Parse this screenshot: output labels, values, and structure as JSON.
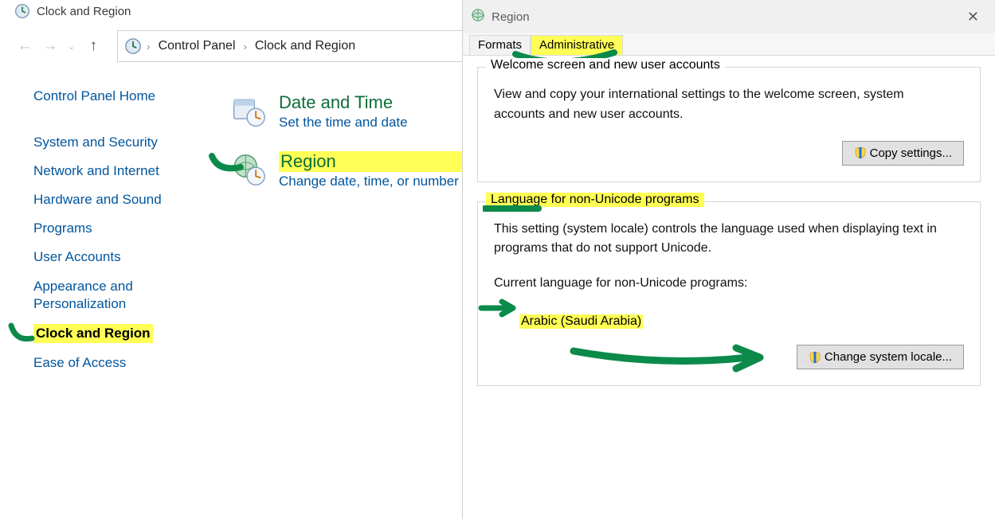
{
  "window": {
    "title": "Clock and Region"
  },
  "breadcrumb": {
    "items": [
      "Control Panel",
      "Clock and Region"
    ]
  },
  "sidebar": {
    "home": "Control Panel Home",
    "items": [
      "System and Security",
      "Network and Internet",
      "Hardware and Sound",
      "Programs",
      "User Accounts",
      "Appearance and Personalization",
      "Clock and Region",
      "Ease of Access"
    ],
    "active_index": 6
  },
  "main": {
    "items": [
      {
        "title": "Date and Time",
        "sub": "Set the time and date",
        "highlighted": false
      },
      {
        "title": "Region",
        "sub": "Change date, time, or number formats",
        "highlighted": true
      }
    ]
  },
  "region_dialog": {
    "title": "Region",
    "tabs": {
      "formats": "Formats",
      "administrative": "Administrative"
    },
    "active_tab": "administrative",
    "group1": {
      "legend": "Welcome screen and new user accounts",
      "text": "View and copy your international settings to the welcome screen, system accounts and new user accounts.",
      "button": "Copy settings..."
    },
    "group2": {
      "legend": "Language for non-Unicode programs",
      "text": "This setting (system locale) controls the language used when displaying text in programs that do not support Unicode.",
      "sublabel": "Current language for non-Unicode programs:",
      "locale": "Arabic (Saudi Arabia)",
      "button": "Change system locale..."
    }
  }
}
